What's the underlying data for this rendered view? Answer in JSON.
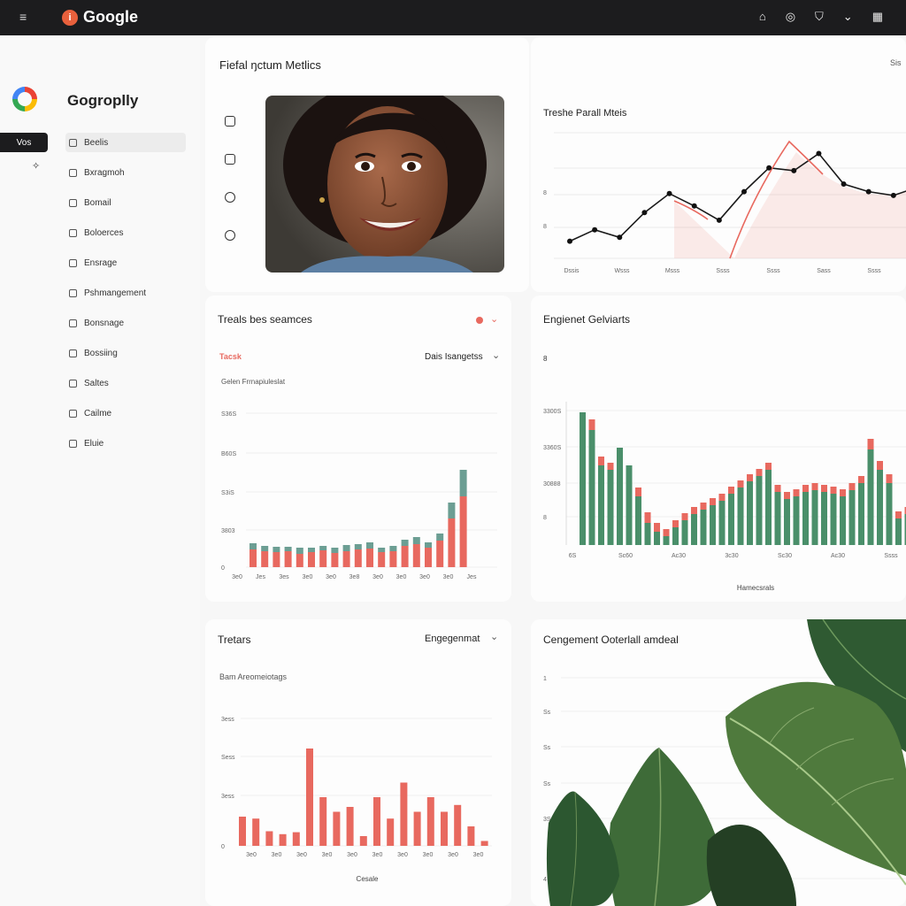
{
  "topbar": {
    "menu_glyph": "≡",
    "brand_badge": "i",
    "brand_title": "Google",
    "icons": [
      "camera-icon",
      "target-icon",
      "shield-icon",
      "chevron-down-icon",
      "grid-icon"
    ]
  },
  "sidebar": {
    "app_name": "Gogroplly",
    "pill_label": "Vos",
    "items": [
      {
        "label": "Beelis"
      },
      {
        "label": "Bxragmoh"
      },
      {
        "label": "Bomail"
      },
      {
        "label": "Boloerces"
      },
      {
        "label": "Ensrage"
      },
      {
        "label": "Pshmangement"
      },
      {
        "label": "Bonsnage"
      },
      {
        "label": "Bossiing"
      },
      {
        "label": "Saltes"
      },
      {
        "label": "Cailme"
      },
      {
        "label": "Eluie"
      }
    ]
  },
  "header": {
    "title": "Fiefal ŋctum Metlics",
    "right": "Sis"
  },
  "profile_card": {
    "icons": [
      "tablet-icon",
      "phone-icon",
      "chat-icon",
      "refresh-icon"
    ],
    "photo_alt": "portrait-photo"
  },
  "trend_card": {
    "title": "Treshe Parall Mteis",
    "y_ticks": [
      "8",
      "8"
    ],
    "x_ticks": [
      "Dssis",
      "Wsss",
      "Msss",
      "Ssss",
      "Ssss",
      "Sass",
      "Ssss"
    ]
  },
  "traffic_card": {
    "title": "Treals bes seamces",
    "filter_left": "Tacsk",
    "filter_right": "Dais Isangetss",
    "subtitle": "Gelen Frrnapiuleslat",
    "y_ticks": [
      "S36S",
      "B60S",
      "S3iS",
      "3803",
      "0"
    ],
    "x_ticks": [
      "3e0",
      "Jes",
      "3es",
      "3e0",
      "3e0",
      "3e8",
      "3e0",
      "3e0",
      "3e0",
      "3e0",
      "Jes"
    ]
  },
  "engagement_card": {
    "title": "Engienet Gelviarts",
    "y_top": "8",
    "y_ticks": [
      "3300S",
      "3360S",
      "30888",
      "8"
    ],
    "x_ticks": [
      "6S",
      "Sc60",
      "Ac30",
      "3c30",
      "Sc30",
      "Ac30",
      "Ssss"
    ],
    "x_label": "Hamecsrals"
  },
  "trends_card": {
    "title": "Tretars",
    "dropdown": "Engegenmat",
    "subtitle": "Bam Areomeiotags",
    "y_ticks": [
      "3ess",
      "Sess",
      "3ess",
      "0"
    ],
    "x_ticks": [
      "3e0",
      "3e0",
      "3e0",
      "3e0",
      "3e0",
      "3e0",
      "3e0",
      "3e0",
      "3e0",
      "3e0"
    ],
    "x_label": "Cesale"
  },
  "cost_card": {
    "title": "Cengement Ooterlall amdeal",
    "y_ticks": [
      "1",
      "Ss",
      "Ss",
      "Ss",
      "3S",
      "4"
    ]
  },
  "colors": {
    "accent_red": "#e8695f",
    "green": "#4a8f6a",
    "teal": "#6c9e93",
    "line": "#1a1a1a"
  },
  "chart_data": [
    {
      "type": "line",
      "title": "Treshe Parall Mteis",
      "x": [
        1,
        2,
        3,
        4,
        5,
        6,
        7,
        8,
        9,
        10,
        11,
        12,
        13,
        14
      ],
      "series": [
        {
          "values": [
            18,
            30,
            22,
            48,
            68,
            55,
            40,
            70,
            95,
            92,
            110,
            78,
            70,
            66,
            75
          ]
        }
      ],
      "ylim": [
        0,
        130
      ]
    },
    {
      "type": "bar",
      "title": "Treals bes seamces",
      "series": [
        {
          "values": [
            20,
            18,
            17,
            18,
            15,
            17,
            19,
            16,
            18,
            20,
            21,
            17,
            18,
            24,
            26,
            22,
            30,
            55,
            80
          ]
        },
        {
          "values": [
            7,
            6,
            6,
            5,
            7,
            5,
            5,
            6,
            7,
            6,
            7,
            5,
            6,
            7,
            8,
            6,
            8,
            18,
            30
          ]
        }
      ]
    },
    {
      "type": "bar",
      "title": "Engienet Gelviarts",
      "series": [
        {
          "values": [
            150,
            130,
            90,
            85,
            110,
            90,
            55,
            25,
            15,
            10,
            20,
            28,
            35,
            40,
            45,
            50,
            58,
            65,
            72,
            78,
            85,
            60,
            52,
            55,
            60,
            62,
            60,
            58,
            55,
            62,
            70,
            108,
            85,
            70,
            30,
            35,
            60,
            90
          ]
        },
        {
          "values": [
            0,
            12,
            10,
            8,
            0,
            0,
            10,
            12,
            10,
            8,
            8,
            8,
            8,
            8,
            8,
            8,
            8,
            8,
            8,
            8,
            8,
            8,
            8,
            8,
            8,
            8,
            8,
            8,
            8,
            8,
            8,
            12,
            10,
            10,
            8,
            8,
            8,
            10
          ]
        }
      ]
    },
    {
      "type": "bar",
      "title": "Tretars",
      "values": [
        30,
        28,
        15,
        12,
        14,
        100,
        50,
        35,
        40,
        10,
        50,
        28,
        65,
        35,
        50,
        35,
        42,
        20,
        5
      ]
    }
  ]
}
